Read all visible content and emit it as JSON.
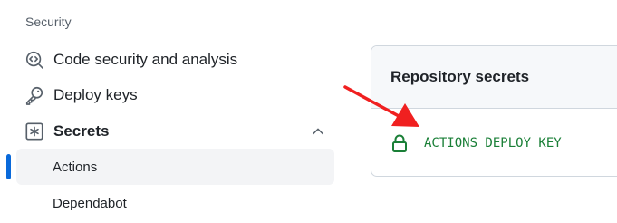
{
  "sidebar": {
    "section_heading": "Security",
    "items": [
      {
        "label": "Code security and analysis",
        "icon": "codescan-icon"
      },
      {
        "label": "Deploy keys",
        "icon": "key-icon"
      },
      {
        "label": "Secrets",
        "icon": "asterisk-box-icon",
        "expanded": true
      }
    ],
    "sub_items": [
      {
        "label": "Actions",
        "active": true
      },
      {
        "label": "Dependabot",
        "active": false
      }
    ]
  },
  "main": {
    "secrets_title": "Repository secrets",
    "secrets": [
      {
        "name": "ACTIONS_DEPLOY_KEY",
        "icon": "lock-icon"
      }
    ]
  },
  "annotation": {
    "arrow_color": "#f02020"
  },
  "colors": {
    "accent": "#0969da",
    "secret_name": "#1a7f37"
  }
}
